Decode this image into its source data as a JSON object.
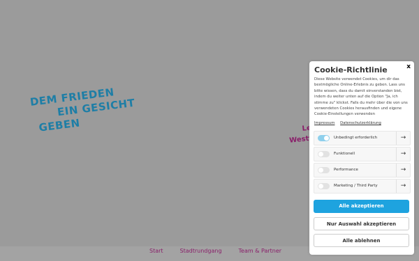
{
  "hero": {
    "line1": "DEM FRIEDEN",
    "line2": "EIN GESICHT",
    "line3": "GEBEN"
  },
  "side": {
    "line1": "Le",
    "line2": "Westf"
  },
  "nav": {
    "items": [
      "Start",
      "Stadtrundgang",
      "Team & Partner"
    ]
  },
  "cookie": {
    "close": "x",
    "title": "Cookie-Richtlinie",
    "text": "Diese Website verwendet Cookies, um dir das bestmögliche Online-Erlebnis zu geben. Lass uns bitte wissen, dass du damit einverstanden bist, indem du weiter unten auf die Option \"Ja, ich stimme zu\" klickst. Falls du mehr über die von uns verwendeten Cookies herausfinden und eigene Cookie-Einstellungen verwenden",
    "links": [
      "Impressum",
      "Datenschutzerklärung"
    ],
    "categories": [
      {
        "label": "Unbedingt erforderlich",
        "enabled": true
      },
      {
        "label": "Funktionell",
        "enabled": false
      },
      {
        "label": "Performance",
        "enabled": false
      },
      {
        "label": "Marketing / Third Party",
        "enabled": false
      }
    ],
    "arrow": "→",
    "buttons": {
      "accept_all": "Alle akzeptieren",
      "accept_selection": "Nur Auswahl akzeptieren",
      "reject_all": "Alle ablehnen"
    }
  },
  "colors": {
    "background": "#9b9b9b",
    "hero_text": "#1e7ea6",
    "accent_purple": "#8a1f6a",
    "primary_button": "#1ea3df",
    "toggle_on": "#8fd0ec"
  }
}
